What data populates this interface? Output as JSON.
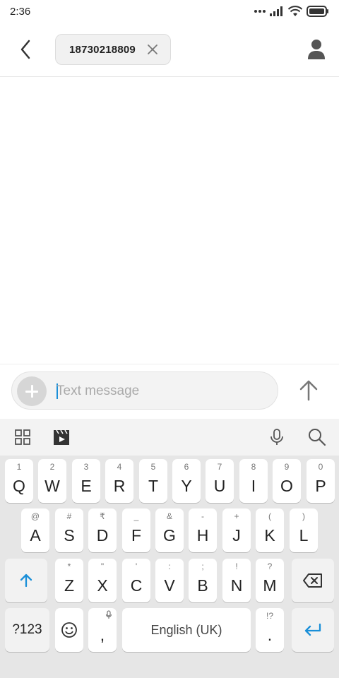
{
  "status_bar": {
    "time": "2:36",
    "icons": [
      "more-dots-icon",
      "signal-icon",
      "wifi-icon",
      "battery-icon"
    ]
  },
  "header": {
    "back_icon": "chevron-left-icon",
    "recipient": "18730218809",
    "chip_close_icon": "close-icon",
    "contact_icon": "person-icon"
  },
  "composer": {
    "add_icon": "plus-icon",
    "placeholder": "Text message",
    "send_icon": "arrow-up-icon"
  },
  "keyboard_toolbar": {
    "left_tools": [
      "grid-icon",
      "clapper-icon"
    ],
    "right_tools": [
      "microphone-icon",
      "search-icon"
    ]
  },
  "keyboard": {
    "row1": [
      {
        "key": "Q",
        "hint": "1"
      },
      {
        "key": "W",
        "hint": "2"
      },
      {
        "key": "E",
        "hint": "3"
      },
      {
        "key": "R",
        "hint": "4"
      },
      {
        "key": "T",
        "hint": "5"
      },
      {
        "key": "Y",
        "hint": "6"
      },
      {
        "key": "U",
        "hint": "7"
      },
      {
        "key": "I",
        "hint": "8"
      },
      {
        "key": "O",
        "hint": "9"
      },
      {
        "key": "P",
        "hint": "0"
      }
    ],
    "row2": [
      {
        "key": "A",
        "hint": "@"
      },
      {
        "key": "S",
        "hint": "#"
      },
      {
        "key": "D",
        "hint": "₹"
      },
      {
        "key": "F",
        "hint": "_"
      },
      {
        "key": "G",
        "hint": "&"
      },
      {
        "key": "H",
        "hint": "-"
      },
      {
        "key": "J",
        "hint": "+"
      },
      {
        "key": "K",
        "hint": "("
      },
      {
        "key": "L",
        "hint": ")"
      }
    ],
    "row3": [
      {
        "key": "Z",
        "hint": "*"
      },
      {
        "key": "X",
        "hint": "\""
      },
      {
        "key": "C",
        "hint": "'"
      },
      {
        "key": "V",
        "hint": ":"
      },
      {
        "key": "B",
        "hint": ";"
      },
      {
        "key": "N",
        "hint": "!"
      },
      {
        "key": "M",
        "hint": "?"
      }
    ],
    "symbols_label": "?123",
    "comma": ",",
    "space_label": "English (UK)",
    "period": ".",
    "period_hint": "!?",
    "accent_color": "#1a8fd8"
  }
}
